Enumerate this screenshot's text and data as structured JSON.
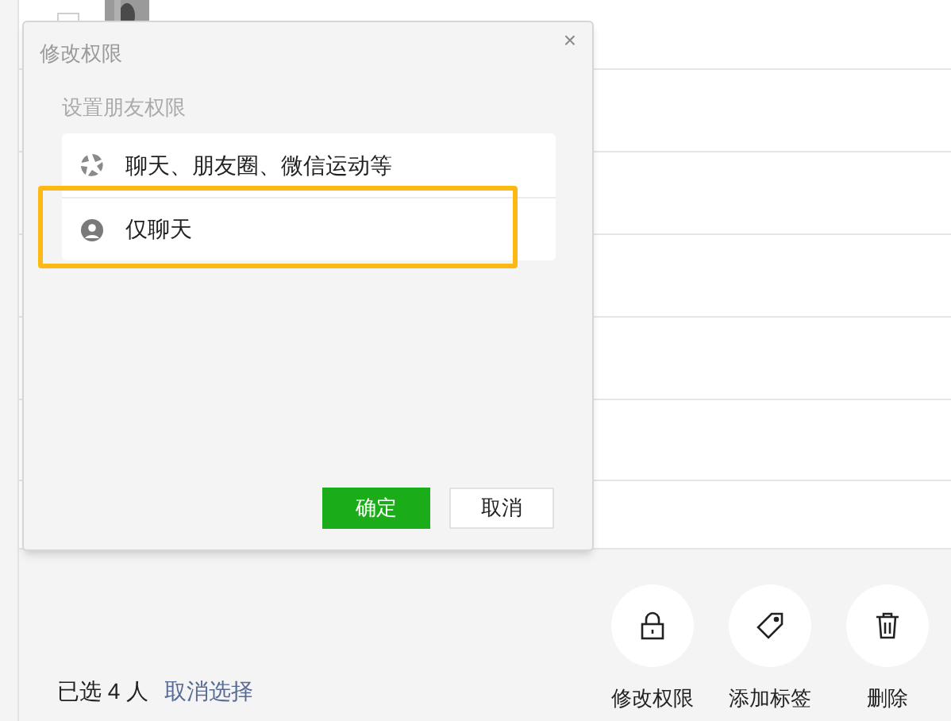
{
  "contacts": [
    {
      "checked": false
    }
  ],
  "dialog": {
    "title": "修改权限",
    "close": "×",
    "subtitle": "设置朋友权限",
    "options": [
      {
        "kind": "full",
        "label": "聊天、朋友圈、微信运动等",
        "highlighted": false
      },
      {
        "kind": "chat",
        "label": "仅聊天",
        "highlighted": true
      }
    ],
    "buttons": [
      {
        "kind": "primary",
        "label": "确定"
      },
      {
        "kind": "secondary",
        "label": "取消"
      }
    ]
  },
  "footer": {
    "selected_prefix": "已选",
    "selected_count": "4",
    "selected_suffix": "人",
    "cancel_link": "取消选择",
    "actions": [
      {
        "kind": "lock",
        "label": "修改权限"
      },
      {
        "kind": "tag",
        "label": "添加标签"
      },
      {
        "kind": "trash",
        "label": "删除"
      }
    ]
  }
}
